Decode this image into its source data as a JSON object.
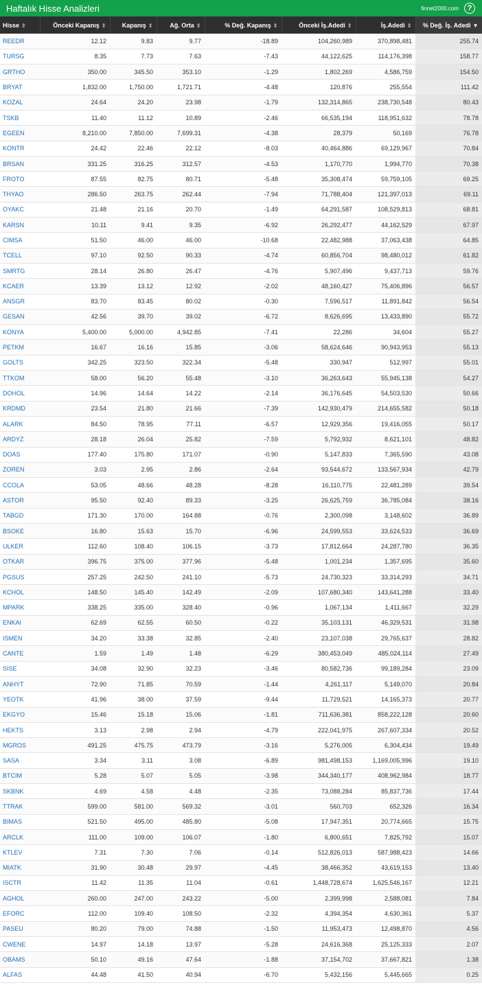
{
  "header": {
    "title": "Haftalık Hisse Analizleri",
    "brand": "finnet2000.com",
    "help_label": "?"
  },
  "table": {
    "columns": [
      "Hisse",
      "Önceki Kapanış",
      "Kapanış",
      "Ağ. Orta",
      "% Değ. Kapanış",
      "Önceki İş.Adedi",
      "İş.Adedi",
      "% Değ. İş. Adedi"
    ],
    "sorted_by": "% Değ. İş. Adedi",
    "rows": [
      [
        "REEDR",
        "12.12",
        "9.83",
        "9.77",
        "-18.89",
        "104,260,989",
        "370,898,481",
        "255.74"
      ],
      [
        "TURSG",
        "8.35",
        "7.73",
        "7.63",
        "-7.43",
        "44,122,625",
        "114,176,398",
        "158.77"
      ],
      [
        "GRTHO",
        "350.00",
        "345.50",
        "353.10",
        "-1.29",
        "1,802,269",
        "4,586,759",
        "154.50"
      ],
      [
        "BRYAT",
        "1,832.00",
        "1,750.00",
        "1,721.71",
        "-4.48",
        "120,876",
        "255,554",
        "111.42"
      ],
      [
        "KOZAL",
        "24.64",
        "24.20",
        "23.98",
        "-1.79",
        "132,314,865",
        "238,730,548",
        "80.43"
      ],
      [
        "TSKB",
        "11.40",
        "11.12",
        "10.89",
        "-2.46",
        "66,535,194",
        "118,951,632",
        "78.78"
      ],
      [
        "EGEEN",
        "8,210.00",
        "7,850.00",
        "7,699.31",
        "-4.38",
        "28,379",
        "50,169",
        "76.78"
      ],
      [
        "KONTR",
        "24.42",
        "22.46",
        "22.12",
        "-8.03",
        "40,464,886",
        "69,129,967",
        "70.84"
      ],
      [
        "BRSAN",
        "331.25",
        "316.25",
        "312.57",
        "-4.53",
        "1,170,770",
        "1,994,770",
        "70.38"
      ],
      [
        "FROTO",
        "87.55",
        "82.75",
        "80.71",
        "-5.48",
        "35,308,474",
        "59,759,105",
        "69.25"
      ],
      [
        "THYAO",
        "286.50",
        "263.75",
        "262.44",
        "-7.94",
        "71,788,404",
        "121,397,013",
        "69.11"
      ],
      [
        "OYAKC",
        "21.48",
        "21.16",
        "20.70",
        "-1.49",
        "64,291,587",
        "108,529,813",
        "68.81"
      ],
      [
        "KARSN",
        "10.11",
        "9.41",
        "9.35",
        "-6.92",
        "26,292,477",
        "44,162,529",
        "67.97"
      ],
      [
        "CIMSA",
        "51.50",
        "46.00",
        "46.00",
        "-10.68",
        "22,482,988",
        "37,063,438",
        "64.85"
      ],
      [
        "TCELL",
        "97.10",
        "92.50",
        "90.33",
        "-4.74",
        "60,856,704",
        "98,480,012",
        "61.82"
      ],
      [
        "SMRTG",
        "28.14",
        "26.80",
        "26.47",
        "-4.76",
        "5,907,496",
        "9,437,713",
        "59.76"
      ],
      [
        "KCAER",
        "13.39",
        "13.12",
        "12.92",
        "-2.02",
        "48,160,427",
        "75,406,896",
        "56.57"
      ],
      [
        "ANSGR",
        "83.70",
        "83.45",
        "80.02",
        "-0.30",
        "7,596,517",
        "11,891,842",
        "56.54"
      ],
      [
        "GESAN",
        "42.56",
        "39.70",
        "39.02",
        "-6.72",
        "8,626,695",
        "13,433,890",
        "55.72"
      ],
      [
        "KONYA",
        "5,400.00",
        "5,000.00",
        "4,942.85",
        "-7.41",
        "22,286",
        "34,604",
        "55.27"
      ],
      [
        "PETKM",
        "16.67",
        "16.16",
        "15.85",
        "-3.06",
        "58,624,646",
        "90,943,953",
        "55.13"
      ],
      [
        "GOLTS",
        "342.25",
        "323.50",
        "322.34",
        "-5.48",
        "330,947",
        "512,997",
        "55.01"
      ],
      [
        "TTKOM",
        "58.00",
        "56.20",
        "55.48",
        "-3.10",
        "36,263,643",
        "55,945,138",
        "54.27"
      ],
      [
        "DOHOL",
        "14.96",
        "14.64",
        "14.22",
        "-2.14",
        "36,176,645",
        "54,503,530",
        "50.66"
      ],
      [
        "KRDMD",
        "23.54",
        "21.80",
        "21.66",
        "-7.39",
        "142,930,479",
        "214,655,582",
        "50.18"
      ],
      [
        "ALARK",
        "84.50",
        "78.95",
        "77.11",
        "-6.57",
        "12,929,356",
        "19,416,055",
        "50.17"
      ],
      [
        "ARDYZ",
        "28.18",
        "26.04",
        "25.82",
        "-7.59",
        "5,792,932",
        "8,621,101",
        "48.82"
      ],
      [
        "DOAS",
        "177.40",
        "175.80",
        "171.07",
        "-0.90",
        "5,147,833",
        "7,365,590",
        "43.08"
      ],
      [
        "ZOREN",
        "3.03",
        "2.95",
        "2.86",
        "-2.64",
        "93,544,672",
        "133,567,934",
        "42.79"
      ],
      [
        "CCOLA",
        "53.05",
        "48.66",
        "48.28",
        "-8.28",
        "16,110,775",
        "22,481,289",
        "39.54"
      ],
      [
        "ASTOR",
        "95.50",
        "92.40",
        "89.33",
        "-3.25",
        "26,625,759",
        "36,785,084",
        "38.16"
      ],
      [
        "TABGD",
        "171.30",
        "170.00",
        "164.88",
        "-0.76",
        "2,300,098",
        "3,148,602",
        "36.89"
      ],
      [
        "BSOKE",
        "16.80",
        "15.63",
        "15.70",
        "-6.96",
        "24,599,553",
        "33,624,533",
        "36.69"
      ],
      [
        "ULKER",
        "112.60",
        "108.40",
        "106.15",
        "-3.73",
        "17,812,664",
        "24,287,780",
        "36.35"
      ],
      [
        "OTKAR",
        "396.75",
        "375.00",
        "377.96",
        "-5.48",
        "1,001,234",
        "1,357,695",
        "35.60"
      ],
      [
        "PGSUS",
        "257.25",
        "242.50",
        "241.10",
        "-5.73",
        "24,730,323",
        "33,314,293",
        "34.71"
      ],
      [
        "KCHOL",
        "148.50",
        "145.40",
        "142.49",
        "-2.09",
        "107,680,340",
        "143,641,288",
        "33.40"
      ],
      [
        "MPARK",
        "338.25",
        "335.00",
        "328.40",
        "-0.96",
        "1,067,134",
        "1,411,667",
        "32.29"
      ],
      [
        "ENKAI",
        "62.69",
        "62.55",
        "60.50",
        "-0.22",
        "35,103,131",
        "46,329,531",
        "31.98"
      ],
      [
        "ISMEN",
        "34.20",
        "33.38",
        "32.85",
        "-2.40",
        "23,107,038",
        "29,765,637",
        "28.82"
      ],
      [
        "CANTE",
        "1.59",
        "1.49",
        "1.48",
        "-6.29",
        "380,453,049",
        "485,024,114",
        "27.49"
      ],
      [
        "SISE",
        "34.08",
        "32.90",
        "32.23",
        "-3.46",
        "80,582,736",
        "99,189,284",
        "23.09"
      ],
      [
        "ANHYT",
        "72.90",
        "71.85",
        "70.59",
        "-1.44",
        "4,261,117",
        "5,149,070",
        "20.84"
      ],
      [
        "YEOTK",
        "41.96",
        "38.00",
        "37.59",
        "-9.44",
        "11,729,521",
        "14,165,373",
        "20.77"
      ],
      [
        "EKGYO",
        "15.46",
        "15.18",
        "15.06",
        "-1.81",
        "711,636,381",
        "858,222,128",
        "20.60"
      ],
      [
        "HEKTS",
        "3.13",
        "2.98",
        "2.94",
        "-4.79",
        "222,041,975",
        "267,607,334",
        "20.52"
      ],
      [
        "MGROS",
        "491.25",
        "475.75",
        "473.79",
        "-3.16",
        "5,276,005",
        "6,304,434",
        "19.49"
      ],
      [
        "SASA",
        "3.34",
        "3.11",
        "3.08",
        "-6.89",
        "981,498,153",
        "1,169,005,996",
        "19.10"
      ],
      [
        "BTCIM",
        "5.28",
        "5.07",
        "5.05",
        "-3.98",
        "344,340,177",
        "408,962,984",
        "18.77"
      ],
      [
        "SKBNK",
        "4.69",
        "4.58",
        "4.48",
        "-2.35",
        "73,088,284",
        "85,837,736",
        "17.44"
      ],
      [
        "TTRAK",
        "599.00",
        "581.00",
        "569.32",
        "-3.01",
        "560,703",
        "652,326",
        "16.34"
      ],
      [
        "BIMAS",
        "521.50",
        "495.00",
        "485.80",
        "-5.08",
        "17,947,351",
        "20,774,665",
        "15.75"
      ],
      [
        "ARCLK",
        "111.00",
        "109.00",
        "106.07",
        "-1.80",
        "6,800,651",
        "7,825,792",
        "15.07"
      ],
      [
        "KTLEV",
        "7.31",
        "7.30",
        "7.06",
        "-0.14",
        "512,826,013",
        "587,988,423",
        "14.66"
      ],
      [
        "MIATK",
        "31.90",
        "30.48",
        "29.97",
        "-4.45",
        "38,466,352",
        "43,619,153",
        "13.40"
      ],
      [
        "ISCTR",
        "11.42",
        "11.35",
        "11.04",
        "-0.61",
        "1,448,728,674",
        "1,625,546,167",
        "12.21"
      ],
      [
        "AGHOL",
        "260.00",
        "247.00",
        "243.22",
        "-5.00",
        "2,399,998",
        "2,588,081",
        "7.84"
      ],
      [
        "EFORC",
        "112.00",
        "109.40",
        "108.50",
        "-2.32",
        "4,394,354",
        "4,630,361",
        "5.37"
      ],
      [
        "PASEU",
        "80.20",
        "79.00",
        "74.88",
        "-1.50",
        "11,953,473",
        "12,498,870",
        "4.56"
      ],
      [
        "CWENE",
        "14.97",
        "14.18",
        "13.97",
        "-5.28",
        "24,616,368",
        "25,125,333",
        "2.07"
      ],
      [
        "OBAMS",
        "50.10",
        "49.16",
        "47.64",
        "-1.88",
        "37,154,702",
        "37,667,821",
        "1.38"
      ],
      [
        "ALFAS",
        "44.48",
        "41.50",
        "40.94",
        "-6.70",
        "5,432,156",
        "5,445,665",
        "0.25"
      ]
    ]
  }
}
